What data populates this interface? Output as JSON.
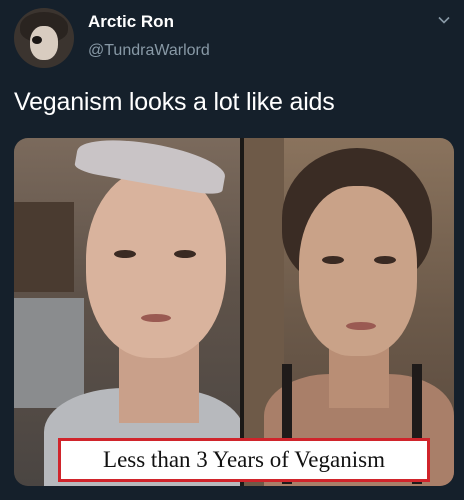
{
  "tweet": {
    "display_name": "Arctic Ron",
    "handle": "@TundraWarlord",
    "text": "Veganism looks a lot like aids",
    "more_icon": "chevron-down-icon"
  },
  "media": {
    "caption": "Less than 3 Years of Veganism"
  },
  "colors": {
    "background": "#15202b",
    "secondary_text": "#8899a6",
    "caption_border": "#d0242b"
  }
}
